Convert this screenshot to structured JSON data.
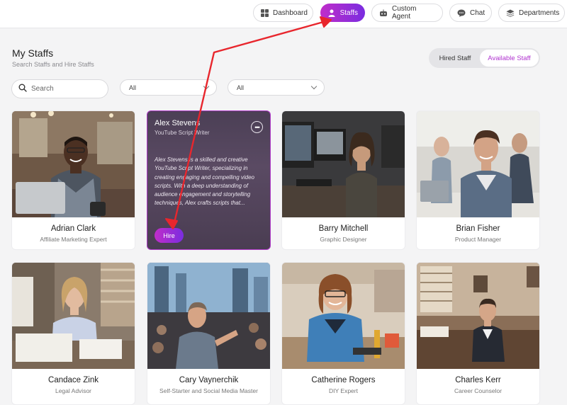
{
  "nav": {
    "items": [
      {
        "label": "Dashboard",
        "icon": "grid-icon"
      },
      {
        "label": "Staffs",
        "icon": "user-icon",
        "active": true
      },
      {
        "label": "Custom Agent",
        "icon": "robot-icon"
      },
      {
        "label": "Chat",
        "icon": "chat-bubble-icon"
      },
      {
        "label": "Departments",
        "icon": "layers-icon"
      }
    ]
  },
  "header": {
    "title": "My Staffs",
    "subtitle": "Search Staffs and Hire Staffs"
  },
  "toggle": {
    "hired": "Hired Staff",
    "available": "Available Staff",
    "selected": "Available Staff"
  },
  "filters": {
    "search_placeholder": "Search",
    "select1": "All",
    "select2": "All"
  },
  "staff": [
    {
      "name": "Adrian Clark",
      "role": "Affiliate Marketing Expert"
    },
    {
      "name": "Alex Stevens",
      "role": "YouTube Script Writer",
      "description": "Alex Stevens is a skilled and creative YouTube Script Writer, specializing in creating engaging and compelling video scripts. With a deep understanding of audience engagement and storytelling techniques, Alex crafts scripts that...",
      "hire_label": "Hire"
    },
    {
      "name": "Barry Mitchell",
      "role": "Graphic Designer"
    },
    {
      "name": "Brian Fisher",
      "role": "Product Manager"
    },
    {
      "name": "Candace Zink",
      "role": "Legal Advisor"
    },
    {
      "name": "Cary Vaynerchik",
      "role": "Self-Starter and Social Media Master"
    },
    {
      "name": "Catherine Rogers",
      "role": "DIY Expert"
    },
    {
      "name": "Charles Kerr",
      "role": "Career Counselor"
    }
  ],
  "colors": {
    "accent_start": "#c02dc9",
    "accent_end": "#7a2de0",
    "annotation_arrow": "#e8262d"
  }
}
